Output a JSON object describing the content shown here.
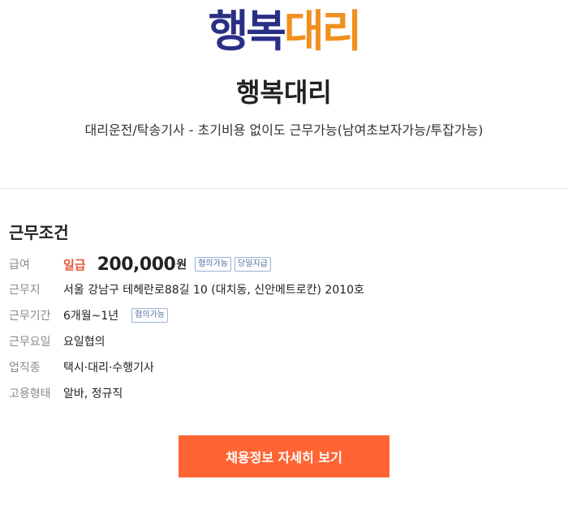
{
  "logo": {
    "part1": "행복",
    "part2": "대리"
  },
  "company": {
    "name": "행복대리",
    "subtitle": "대리운전/탁송기사 - 초기비용 없이도 근무가능(남여초보자가능/투잡가능)"
  },
  "conditions": {
    "title": "근무조건",
    "salary": {
      "label": "급여",
      "pay_type": "일급",
      "amount": "200,000",
      "unit": "원",
      "badges": [
        "협의가능",
        "당일지급"
      ]
    },
    "location": {
      "label": "근무지",
      "value": "서울 강남구 테헤란로88길 10 (대치동, 신안메트로칸) 2010호"
    },
    "period": {
      "label": "근무기간",
      "value": "6개월~1년",
      "badge": "협의가능"
    },
    "days": {
      "label": "근무요일",
      "value": "요일협의"
    },
    "job_type": {
      "label": "업직종",
      "value": "택시·대리·수행기사"
    },
    "employment": {
      "label": "고용형태",
      "value": "알바, 정규직"
    }
  },
  "cta": {
    "label": "채용정보 자세히 보기"
  },
  "colors": {
    "logo_blue": "#2a2f86",
    "logo_orange": "#f0901e",
    "accent": "#ff6534",
    "pay_type": "#e8583a"
  }
}
